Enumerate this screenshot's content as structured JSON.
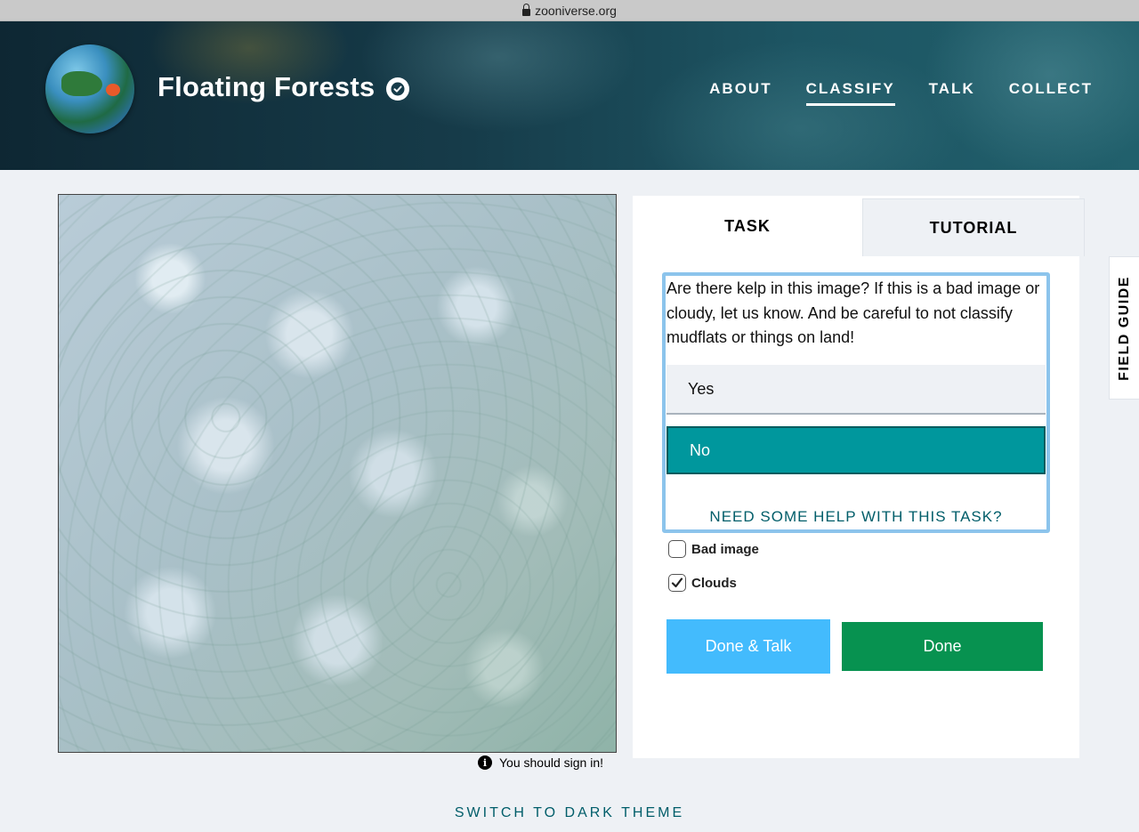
{
  "browser": {
    "url": "zooniverse.org"
  },
  "header": {
    "project_title": "Floating Forests",
    "nav": [
      {
        "label": "ABOUT",
        "active": false
      },
      {
        "label": "CLASSIFY",
        "active": true
      },
      {
        "label": "TALK",
        "active": false
      },
      {
        "label": "COLLECT",
        "active": false
      }
    ]
  },
  "viewer": {
    "signin_notice": "You should sign in!"
  },
  "panel": {
    "tabs": {
      "task": "TASK",
      "tutorial": "TUTORIAL"
    },
    "question": "Are there kelp in this image? If this is a bad image or cloudy, let us know. And be careful to not classify mudflats or things on land!",
    "answers": [
      {
        "label": "Yes",
        "selected": false
      },
      {
        "label": "No",
        "selected": true
      }
    ],
    "help_link": "NEED SOME HELP WITH THIS TASK?",
    "flags": [
      {
        "label": "Bad image",
        "checked": false
      },
      {
        "label": "Clouds",
        "checked": true
      }
    ],
    "done_talk_label": "Done & Talk",
    "done_label": "Done"
  },
  "field_guide": {
    "label": "FIELD GUIDE"
  },
  "footer": {
    "theme_link": "SWITCH TO DARK THEME"
  },
  "colors": {
    "accent_teal": "#00979d",
    "done_green": "#079250",
    "done_talk_blue": "#43bbfd",
    "link_teal": "#005d69"
  },
  "icons": [
    "lock-icon",
    "verified-icon",
    "info-icon",
    "checkmark-icon"
  ]
}
